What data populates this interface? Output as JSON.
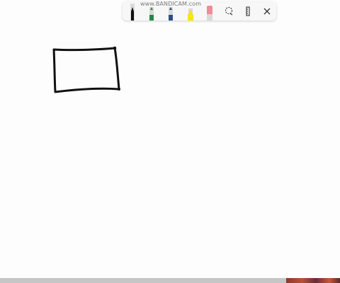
{
  "watermark": "www.BANDICAM.com",
  "toolbar": {
    "pens": [
      {
        "name": "black-pen",
        "color": "#1a1a1a"
      },
      {
        "name": "green-pen",
        "color": "#1f8a4c"
      },
      {
        "name": "blue-pen",
        "color": "#2a4f8a"
      },
      {
        "name": "yellow-highlighter",
        "color": "#f4e800"
      },
      {
        "name": "eraser",
        "color": "#f08b9a"
      }
    ],
    "icons": [
      "lasso-select-icon",
      "ruler-icon",
      "close-icon"
    ]
  },
  "colors": {
    "background": "#fdfdfd",
    "stroke": "#111111"
  }
}
